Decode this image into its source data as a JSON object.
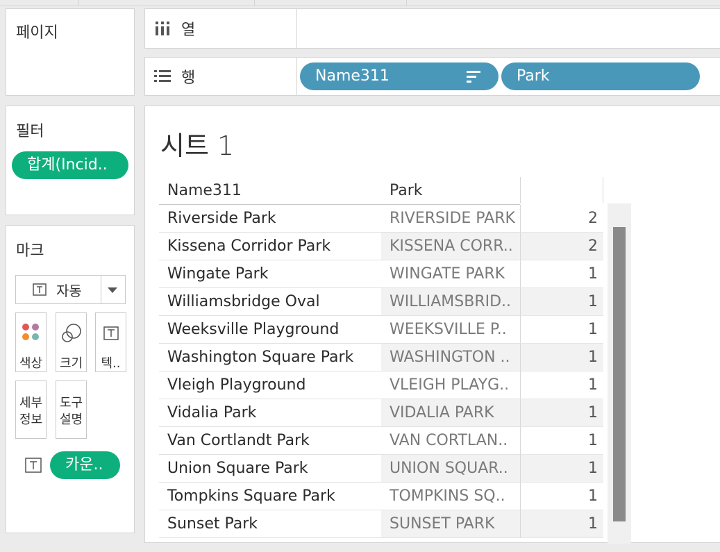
{
  "pages_panel": {
    "title": "페이지"
  },
  "columns_shelf": {
    "label": "열"
  },
  "rows_shelf": {
    "label": "행",
    "pills": [
      "Name311",
      "Park"
    ]
  },
  "filters_panel": {
    "title": "필터",
    "pill": "합계(Incid.."
  },
  "marks_panel": {
    "title": "마크",
    "mark_type": "자동",
    "buttons": [
      {
        "label": "색상",
        "icon": "color-dots-icon"
      },
      {
        "label": "크기",
        "icon": "size-circles-icon"
      },
      {
        "label": "텍..",
        "icon": "text-t-icon"
      },
      {
        "label": "세부\n정보",
        "icon": "none"
      },
      {
        "label": "도구\n설명",
        "icon": "none"
      }
    ],
    "field_pill": "카운.."
  },
  "sheet": {
    "title": "시트 1",
    "headers": [
      "Name311",
      "Park"
    ],
    "rows": [
      {
        "name": "Riverside Park",
        "park": "RIVERSIDE PARK",
        "value": "2"
      },
      {
        "name": "Kissena Corridor Park",
        "park": "KISSENA CORR..",
        "value": "2"
      },
      {
        "name": "Wingate Park",
        "park": "WINGATE PARK",
        "value": "1"
      },
      {
        "name": "Williamsbridge Oval",
        "park": "WILLIAMSBRID..",
        "value": "1"
      },
      {
        "name": "Weeksville Playground",
        "park": "WEEKSVILLE P..",
        "value": "1"
      },
      {
        "name": "Washington Square Park",
        "park": "WASHINGTON ..",
        "value": "1"
      },
      {
        "name": "Vleigh Playground",
        "park": "VLEIGH PLAYG..",
        "value": "1"
      },
      {
        "name": "Vidalia Park",
        "park": "VIDALIA PARK",
        "value": "1"
      },
      {
        "name": "Van Cortlandt Park",
        "park": "VAN CORTLAN..",
        "value": "1"
      },
      {
        "name": "Union Square Park",
        "park": "UNION SQUAR..",
        "value": "1"
      },
      {
        "name": "Tompkins Square Park",
        "park": "TOMPKINS SQ..",
        "value": "1"
      },
      {
        "name": "Sunset Park",
        "park": "SUNSET PARK",
        "value": "1"
      }
    ]
  },
  "colors": {
    "green_pill": "#0db07c",
    "blue_pill": "#4a98b9"
  }
}
